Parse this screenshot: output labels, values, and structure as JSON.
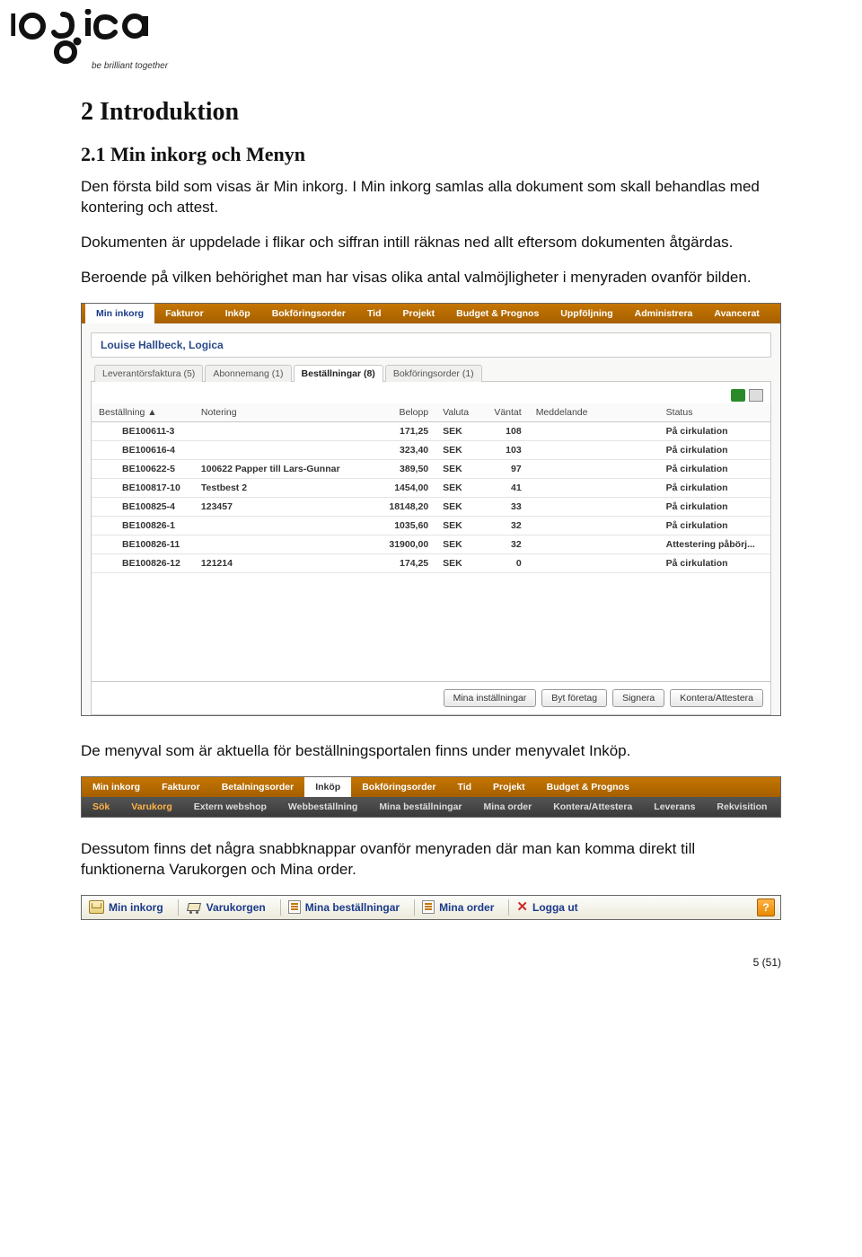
{
  "logo": {
    "tagline": "be brilliant together"
  },
  "section": {
    "title": "2 Introduktion",
    "sub": "2.1    Min inkorg och Menyn"
  },
  "para": {
    "p1": "Den första bild som visas är Min inkorg. I Min inkorg samlas alla dokument som skall behandlas med kontering och attest.",
    "p2": "Dokumenten är uppdelade i flikar och siffran intill räknas ned allt eftersom dokumenten åtgärdas.",
    "p3": "Beroende på vilken behörighet man har visas olika antal valmöjligheter i menyraden ovanför bilden.",
    "p4": "De menyval som är aktuella för beställningsportalen finns under menyvalet Inköp.",
    "p5": "Dessutom finns det några snabbknappar ovanför menyraden där man kan komma direkt till funktionerna Varukorgen och Mina order."
  },
  "shot1": {
    "menu": [
      "Min inkorg",
      "Fakturor",
      "Inköp",
      "Bokföringsorder",
      "Tid",
      "Projekt",
      "Budget & Prognos",
      "Uppföljning",
      "Administrera",
      "Avancerat"
    ],
    "active_index": 0,
    "user": "Louise Hallbeck, Logica",
    "tabs": [
      "Leverantörsfaktura (5)",
      "Abonnemang (1)",
      "Beställningar (8)",
      "Bokföringsorder (1)"
    ],
    "tab_active": 2,
    "cols": [
      "Beställning ▲",
      "Notering",
      "Belopp",
      "Valuta",
      "Väntat",
      "Meddelande",
      "Status"
    ],
    "rows": [
      [
        "BE100611-3",
        "",
        "171,25",
        "SEK",
        "108",
        "",
        "På cirkulation"
      ],
      [
        "BE100616-4",
        "",
        "323,40",
        "SEK",
        "103",
        "",
        "På cirkulation"
      ],
      [
        "BE100622-5",
        "100622 Papper till Lars-Gunnar",
        "389,50",
        "SEK",
        "97",
        "",
        "På cirkulation"
      ],
      [
        "BE100817-10",
        "Testbest 2",
        "1454,00",
        "SEK",
        "41",
        "",
        "På cirkulation"
      ],
      [
        "BE100825-4",
        "123457",
        "18148,20",
        "SEK",
        "33",
        "",
        "På cirkulation"
      ],
      [
        "BE100826-1",
        "",
        "1035,60",
        "SEK",
        "32",
        "",
        "På cirkulation"
      ],
      [
        "BE100826-11",
        "",
        "31900,00",
        "SEK",
        "32",
        "",
        "Attestering påbörj..."
      ],
      [
        "BE100826-12",
        "121214",
        "174,25",
        "SEK",
        "0",
        "",
        "På cirkulation"
      ]
    ],
    "buttons": [
      "Mina inställningar",
      "Byt företag",
      "Signera",
      "Kontera/Attestera"
    ]
  },
  "shot2": {
    "top": [
      "Min inkorg",
      "Fakturor",
      "Betalningsorder",
      "Inköp",
      "Bokföringsorder",
      "Tid",
      "Projekt",
      "Budget & Prognos"
    ],
    "top_active": 3,
    "sub": [
      "Sök",
      "Varukorg",
      "Extern webshop",
      "Webbeställning",
      "Mina beställningar",
      "Mina order",
      "Kontera/Attestera",
      "Leverans",
      "Rekvisition"
    ],
    "sub_hot": [
      0,
      1
    ]
  },
  "shot3": {
    "items": [
      {
        "icon": "mail",
        "label": "Min inkorg"
      },
      {
        "icon": "cart",
        "label": "Varukorgen"
      },
      {
        "icon": "doc",
        "label": "Mina beställningar"
      },
      {
        "icon": "doc",
        "label": "Mina order"
      },
      {
        "icon": "x",
        "label": "Logga ut"
      }
    ],
    "help": "?"
  },
  "footer": "5 (51)"
}
